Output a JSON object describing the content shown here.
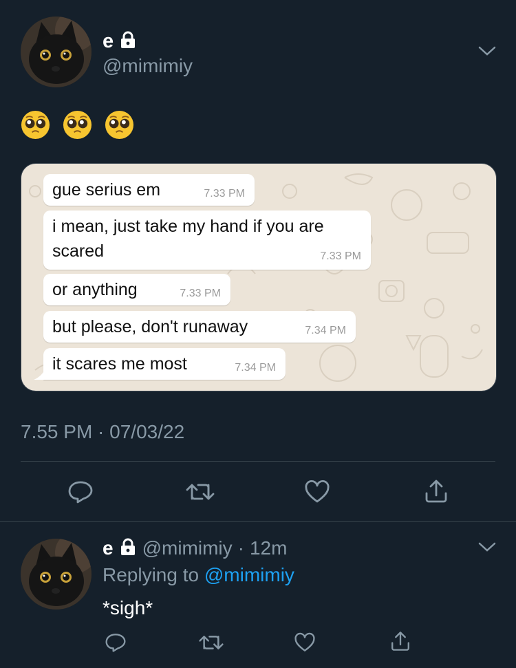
{
  "tweet": {
    "author_name": "e",
    "handle": "@mimimiy",
    "emojis": "🥺 🥺 🥺",
    "timestamp": "7.55 PM · 07/03/22"
  },
  "chat": [
    {
      "text_lines": [
        "gue serius em"
      ],
      "time": "7.33 PM"
    },
    {
      "text_lines": [
        "i mean, just take my hand if you are",
        "scared"
      ],
      "time": "7.33 PM"
    },
    {
      "text_lines": [
        "or anything"
      ],
      "time": "7.33 PM"
    },
    {
      "text_lines": [
        "but please, don't runaway"
      ],
      "time": "7.34 PM"
    },
    {
      "text_lines": [
        "it scares me most"
      ],
      "time": "7.34 PM"
    }
  ],
  "reply": {
    "author_name": "e",
    "handle": "@mimimiy",
    "separator": "·",
    "time_ago": "12m",
    "replying_prefix": "Replying to",
    "replying_handle": "@mimimiy",
    "text": "*sigh*"
  },
  "icons": {
    "lock": "lock-icon",
    "chevron": "chevron-down-icon",
    "reply": "reply-icon",
    "retweet": "retweet-icon",
    "like": "heart-icon",
    "share": "share-icon"
  },
  "colors": {
    "background": "#15202b",
    "secondary_text": "#8899a6",
    "link": "#1da1f2",
    "divider": "#38444d"
  }
}
